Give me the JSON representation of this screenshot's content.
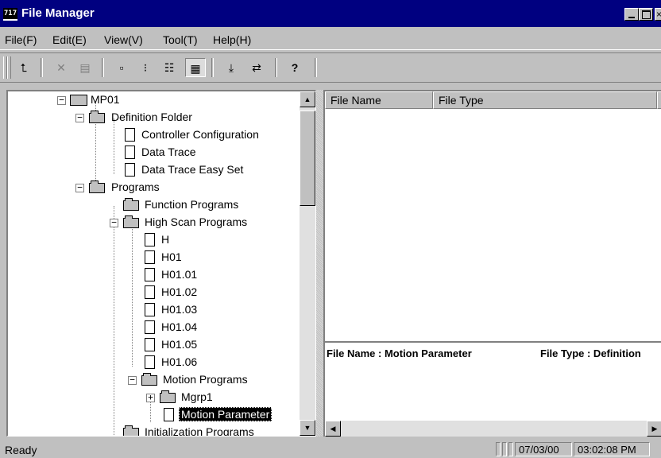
{
  "window": {
    "title": "File Manager",
    "app_icon_text": "717"
  },
  "menu": [
    {
      "label": "File(F)"
    },
    {
      "label": "Edit(E)"
    },
    {
      "label": "View(V)"
    },
    {
      "label": "Tool(T)"
    },
    {
      "label": "Help(H)"
    }
  ],
  "toolbar": {
    "buttons": [
      {
        "icon": "up-folder-icon",
        "glyph": "⮤"
      },
      {
        "icon": "delete-icon",
        "glyph": "✕"
      },
      {
        "icon": "properties-icon",
        "glyph": "▤"
      },
      {
        "icon": "large-icons-icon",
        "glyph": "▫"
      },
      {
        "icon": "small-icons-icon",
        "glyph": "⁝"
      },
      {
        "icon": "list-view-icon",
        "glyph": "☷"
      },
      {
        "icon": "details-view-icon",
        "glyph": "▦"
      },
      {
        "icon": "download-icon",
        "glyph": "⤓"
      },
      {
        "icon": "transfer-icon",
        "glyph": "⇄"
      },
      {
        "icon": "help-icon",
        "glyph": "?"
      }
    ]
  },
  "tree": [
    {
      "label": "MP01",
      "icon": "drive-icon",
      "expander": "−"
    },
    {
      "label": "Definition Folder",
      "icon": "folder-icon",
      "expander": "−"
    },
    {
      "label": "Controller Configuration",
      "icon": "document-icon"
    },
    {
      "label": "Data Trace",
      "icon": "document-icon"
    },
    {
      "label": "Data Trace Easy Set",
      "icon": "document-icon"
    },
    {
      "label": "Programs",
      "icon": "folder-icon",
      "expander": "−"
    },
    {
      "label": "Function Programs",
      "icon": "folder-icon"
    },
    {
      "label": "High Scan Programs",
      "icon": "folder-icon",
      "expander": "−"
    },
    {
      "label": "H",
      "icon": "document-icon"
    },
    {
      "label": "H01",
      "icon": "document-icon"
    },
    {
      "label": "H01.01",
      "icon": "document-icon"
    },
    {
      "label": "H01.02",
      "icon": "document-icon"
    },
    {
      "label": "H01.03",
      "icon": "document-icon"
    },
    {
      "label": "H01.04",
      "icon": "document-icon"
    },
    {
      "label": "H01.05",
      "icon": "document-icon"
    },
    {
      "label": "H01.06",
      "icon": "document-icon"
    },
    {
      "label": "Motion Programs",
      "icon": "folder-icon",
      "expander": "−"
    },
    {
      "label": "Mgrp1",
      "icon": "folder-icon",
      "expander": "+"
    },
    {
      "label": "Motion Parameter",
      "icon": "document-icon",
      "selected": true
    },
    {
      "label": "Initialization Programs",
      "icon": "folder-icon"
    }
  ],
  "list": {
    "columns": [
      "File Name",
      "File Type"
    ]
  },
  "detail": {
    "file_name": "File Name : Motion Parameter",
    "file_type": "File Type : Definition"
  },
  "status": {
    "text": "Ready",
    "date": "07/03/00",
    "time": "03:02:08 PM"
  }
}
